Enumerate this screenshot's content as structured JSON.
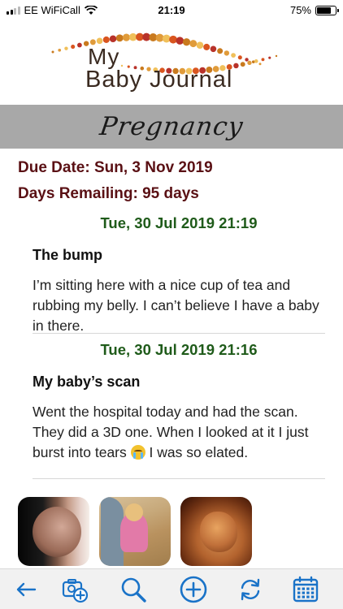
{
  "status_bar": {
    "carrier": "EE WiFiCall",
    "time": "21:19",
    "battery": "75%",
    "battery_level": 0.75
  },
  "logo": {
    "line1": "My",
    "line2": "Baby Journal"
  },
  "header": {
    "title": "Pregnancy"
  },
  "info": {
    "due_date": "Due Date: Sun, 3 Nov 2019",
    "days_remaining": "Days Remailing: 95 days"
  },
  "entries": [
    {
      "date": "Tue, 30 Jul 2019 21:19",
      "title": "The bump",
      "body": "I’m sitting here with a nice cup of tea and rubbing my belly. I can’t believe I have a baby in there."
    },
    {
      "date": "Tue, 30 Jul 2019 21:16",
      "title": "My baby’s scan",
      "body_before_emoji": "Went the hospital today and had the scan. They did a 3D one. When I looked at it I just burst into tears ",
      "body_after_emoji": " I was so elated."
    }
  ],
  "toolbar": {
    "icons": [
      "back-arrow-icon",
      "add-photo-icon",
      "search-icon",
      "add-icon",
      "sync-icon",
      "calendar-icon"
    ],
    "accent_color": "#1a73c8"
  },
  "colors": {
    "info_text": "#5a1014",
    "date_text": "#1f5b1a",
    "header_band": "#a8a8a8"
  }
}
